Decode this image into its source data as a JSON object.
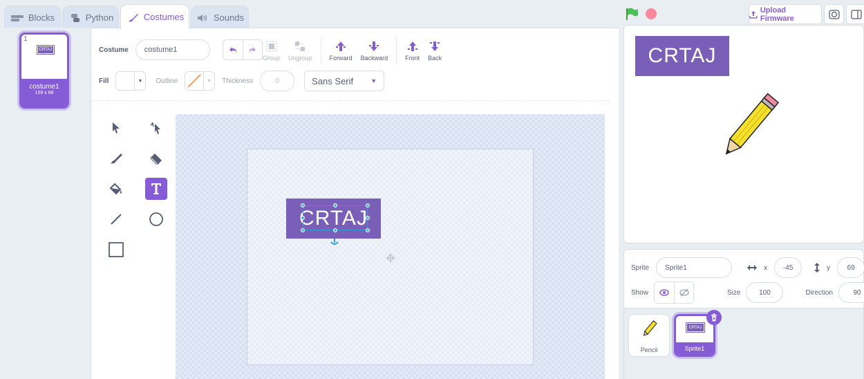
{
  "tabs": [
    {
      "label": "Blocks",
      "icon": "blocks-icon"
    },
    {
      "label": "Python",
      "icon": "python-icon"
    },
    {
      "label": "Costumes",
      "icon": "brush-icon"
    },
    {
      "label": "Sounds",
      "icon": "speaker-icon"
    }
  ],
  "costume_list": {
    "items": [
      {
        "number": "1",
        "name": "costume1",
        "size": "159 x 68",
        "thumb_text": "CRTAJ"
      }
    ]
  },
  "editor": {
    "costume_label": "Costume",
    "costume_name": "costume1",
    "group_label": "Group",
    "ungroup_label": "Ungroup",
    "forward_label": "Forward",
    "backward_label": "Backward",
    "front_label": "Front",
    "back_label": "Back",
    "fill_label": "Fill",
    "outline_label": "Outline",
    "thickness_label": "Thickness",
    "thickness_value": "0",
    "font_value": "Sans Serif",
    "canvas_text": "CRTAJ"
  },
  "stage": {
    "upload_label": "Upload Firmware",
    "sprite_text": "CRTAJ"
  },
  "sprite_info": {
    "sprite_label": "Sprite",
    "sprite_name": "Sprite1",
    "x_label": "x",
    "x_value": "-45",
    "y_label": "y",
    "y_value": "69",
    "show_label": "Show",
    "size_label": "Size",
    "size_value": "100",
    "direction_label": "Direction",
    "direction_value": "90"
  },
  "sprite_tray": {
    "items": [
      {
        "name": "Pencil"
      },
      {
        "name": "Sprite1",
        "thumb_text": "CRTAJ"
      }
    ]
  },
  "colors": {
    "accent": "#855cd6",
    "sprite_fill": "#7a5fb8",
    "green_flag": "#4cbf56",
    "stop": "#ff6680"
  }
}
